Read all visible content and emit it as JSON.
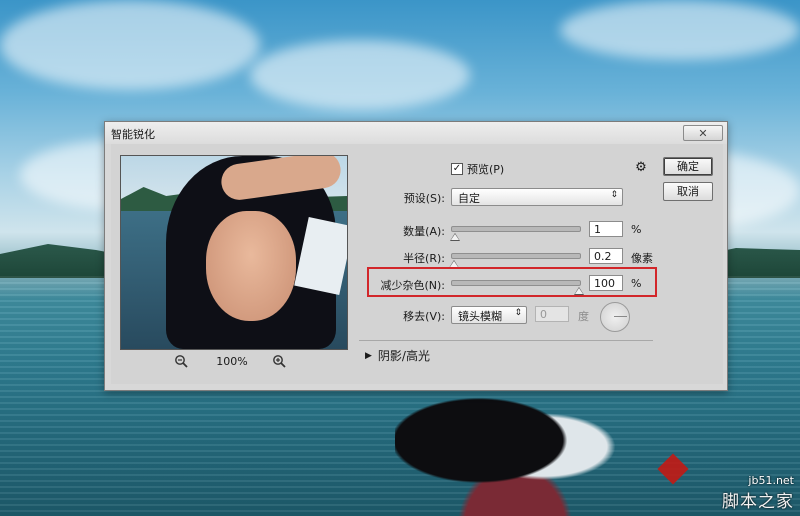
{
  "dialog": {
    "title": "智能锐化",
    "close_glyph": "✕",
    "zoom": {
      "percent": "100%"
    },
    "preview_checkbox": {
      "label": "预览(P)",
      "checked": true,
      "check_glyph": "✓"
    },
    "gear_glyph": "⚙",
    "preset": {
      "label": "预设(S):",
      "value": "自定",
      "arrow": "⇕"
    },
    "amount": {
      "label": "数量(A):",
      "value": "1",
      "unit": "%",
      "level": 0.01
    },
    "radius": {
      "label": "半径(R):",
      "value": "0.2",
      "unit": "像素",
      "level": 0.0
    },
    "reduce_noise": {
      "label": "减少杂色(N):",
      "value": "100",
      "unit": "%",
      "level": 1.0
    },
    "remove": {
      "label": "移去(V):",
      "value": "镜头模糊",
      "angle_value": "0",
      "angle_unit": "度",
      "arrow": "⇕"
    },
    "shadows_highlights": {
      "label": "阴影/高光",
      "arrow": "▶"
    },
    "ok_label": "确定",
    "cancel_label": "取消"
  },
  "watermark": {
    "url": "jb51.net",
    "name": "脚本之家"
  },
  "colors": {
    "highlight_box": "#d2262a"
  }
}
